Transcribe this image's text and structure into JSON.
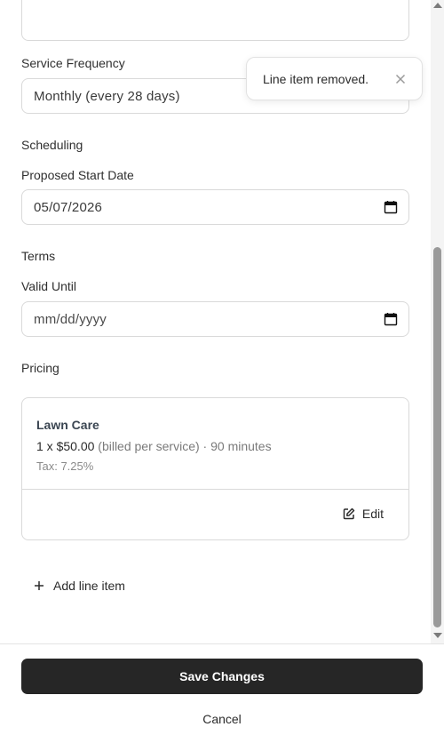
{
  "form": {
    "service_frequency": {
      "label": "Service Frequency",
      "value": "Monthly (every 28 days)"
    },
    "scheduling": {
      "section_label": "Scheduling",
      "start_date": {
        "label": "Proposed Start Date",
        "value": "05/07/2026"
      }
    },
    "terms": {
      "section_label": "Terms",
      "valid_until": {
        "label": "Valid Until",
        "placeholder": "mm/dd/yyyy"
      }
    },
    "pricing": {
      "section_label": "Pricing",
      "line_items": [
        {
          "name": "Lawn Care",
          "quantity_price": "1 x $50.00",
          "billing_note": "(billed per service)",
          "separator": "·",
          "duration": "90 minutes",
          "tax": "Tax: 7.25%",
          "edit_label": "Edit"
        }
      ],
      "add_line_label": "Add line item"
    }
  },
  "toast": {
    "message": "Line item removed."
  },
  "footer": {
    "save_label": "Save Changes",
    "cancel_label": "Cancel"
  },
  "scrollbar": {
    "position_fraction": 0.62
  },
  "icons": {
    "calendar": "calendar-icon",
    "chevron": "chevron-down-icon",
    "edit": "edit-icon",
    "plus": "plus-icon",
    "close": "close-icon"
  },
  "colors": {
    "primary_button": "#262626",
    "item_title": "#3b4652"
  }
}
